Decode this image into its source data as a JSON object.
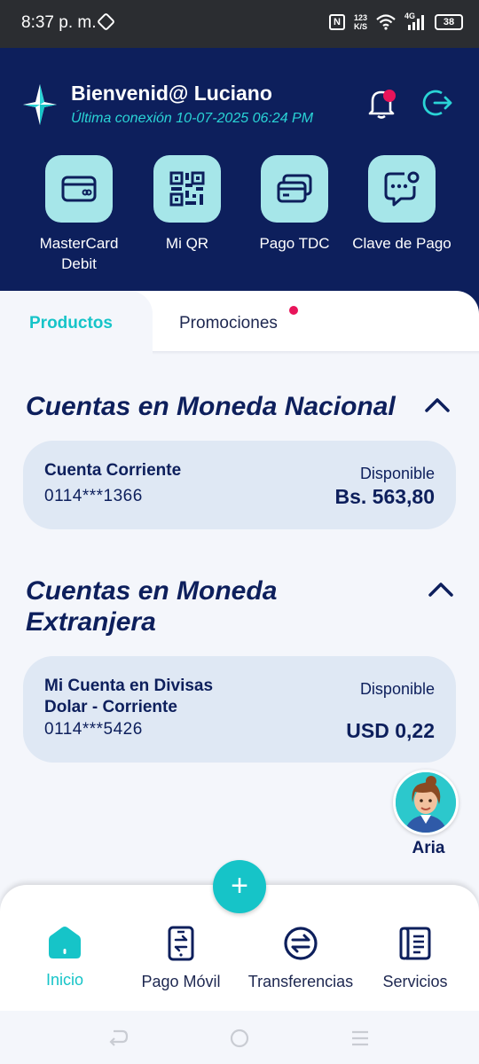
{
  "status_bar": {
    "time": "8:37 p. m.",
    "nfc": "N",
    "speed_value": "123",
    "speed_unit": "K/S",
    "network": "4G",
    "battery": "38"
  },
  "header": {
    "welcome": "Bienvenid@ Luciano",
    "last_login": "Última conexión 10-07-2025 06:24 PM",
    "has_notification": true
  },
  "quick_actions": [
    {
      "label": "MasterCard Debit",
      "icon": "card-icon"
    },
    {
      "label": "Mi QR",
      "icon": "qr-icon"
    },
    {
      "label": "Pago TDC",
      "icon": "cards-icon"
    },
    {
      "label": "Clave de Pago",
      "icon": "chat-key-icon"
    }
  ],
  "tabs": {
    "productos": "Productos",
    "promociones": "Promociones"
  },
  "sections": {
    "nacional": {
      "title": "Cuentas en Moneda Nacional",
      "accounts": [
        {
          "name": "Cuenta Corriente",
          "number": "0114***1366",
          "available_label": "Disponible",
          "amount": "Bs. 563,80"
        }
      ]
    },
    "extranjera": {
      "title_line1": "Cuentas en Moneda",
      "title_line2": "Extranjera",
      "accounts": [
        {
          "name_line1": "Mi Cuenta en Divisas",
          "name_line2": "Dolar - Corriente",
          "number": "0114***5426",
          "available_label": "Disponible",
          "amount": "USD 0,22"
        }
      ]
    }
  },
  "assistant": {
    "name": "Aria"
  },
  "fab": {
    "label": "+"
  },
  "bottom_nav": [
    {
      "label": "Inicio",
      "active": true
    },
    {
      "label": "Pago Móvil",
      "active": false
    },
    {
      "label": "Transferencias",
      "active": false
    },
    {
      "label": "Servicios",
      "active": false
    }
  ],
  "colors": {
    "header_bg": "#0d1f5c",
    "accent": "#16c4c8",
    "card_bg": "#dfe8f4",
    "notification": "#e8145a"
  }
}
